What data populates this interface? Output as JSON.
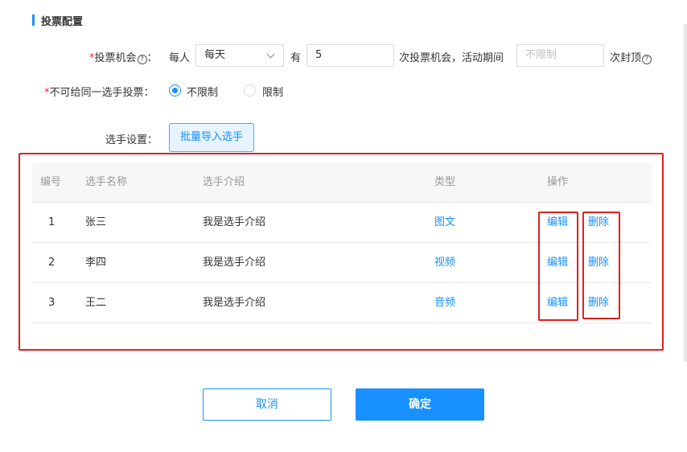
{
  "section": {
    "title": "投票配置"
  },
  "vote_chance": {
    "required_mark": "*",
    "label": "投票机会",
    "help_glyph": "?",
    "colon": "：",
    "per_label": "每人",
    "period_value": "每天",
    "has_label": "有",
    "count_value": "5",
    "middle_text": "次投票机会，活动期间",
    "limit_placeholder": "不限制",
    "suffix_text": "次封顶"
  },
  "same_player": {
    "required_mark": "*",
    "label": "不可给同一选手投票：",
    "options": [
      {
        "label": "不限制",
        "checked": true
      },
      {
        "label": "限制",
        "checked": false
      }
    ]
  },
  "player_settings": {
    "label": "选手设置：",
    "import_button": "批量导入选手"
  },
  "table": {
    "headers": [
      "编号",
      "选手名称",
      "选手介绍",
      "类型",
      "操作"
    ],
    "rows": [
      {
        "id": "1",
        "name": "张三",
        "intro": "我是选手介绍",
        "type": "图文",
        "edit": "编辑",
        "delete": "删除"
      },
      {
        "id": "2",
        "name": "李四",
        "intro": "我是选手介绍",
        "type": "视频",
        "edit": "编辑",
        "delete": "删除"
      },
      {
        "id": "3",
        "name": "王二",
        "intro": "我是选手介绍",
        "type": "音频",
        "edit": "编辑",
        "delete": "删除"
      }
    ]
  },
  "footer": {
    "cancel": "取消",
    "confirm": "确定"
  },
  "colors": {
    "accent": "#1890ff",
    "highlight": "#e02020",
    "required": "#f5222d"
  }
}
